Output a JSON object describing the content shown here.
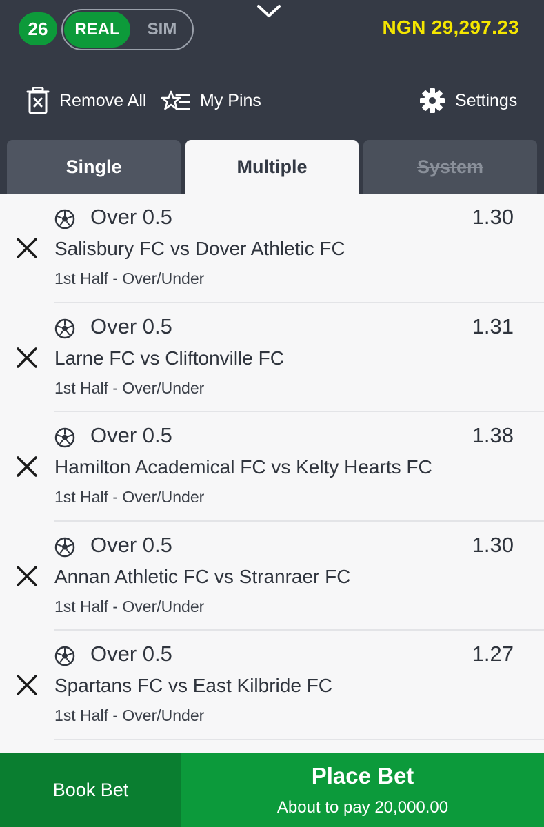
{
  "header": {
    "count_badge": "26",
    "mode": {
      "real_label": "REAL",
      "sim_label": "SIM",
      "selected": "REAL"
    },
    "balance": "NGN 29,297.23",
    "tools": {
      "remove_all": "Remove All",
      "my_pins": "My Pins",
      "settings": "Settings"
    }
  },
  "tabs": [
    {
      "label": "Single",
      "active": false
    },
    {
      "label": "Multiple",
      "active": true
    },
    {
      "label": "System",
      "active": false,
      "disabled": true
    }
  ],
  "bets": [
    {
      "selection": "Over 0.5",
      "odds": "1.30",
      "match": "Salisbury FC vs Dover Athletic FC",
      "market": "1st Half - Over/Under"
    },
    {
      "selection": "Over 0.5",
      "odds": "1.31",
      "match": "Larne FC vs Cliftonville FC",
      "market": "1st Half - Over/Under"
    },
    {
      "selection": "Over 0.5",
      "odds": "1.38",
      "match": "Hamilton Academical FC vs Kelty Hearts FC",
      "market": "1st Half - Over/Under"
    },
    {
      "selection": "Over 0.5",
      "odds": "1.30",
      "match": "Annan Athletic FC vs Stranraer FC",
      "market": "1st Half - Over/Under"
    },
    {
      "selection": "Over 0.5",
      "odds": "1.27",
      "match": "Spartans FC vs East Kilbride FC",
      "market": "1st Half - Over/Under"
    }
  ],
  "footer": {
    "book_bet": "Book Bet",
    "place_bet": "Place Bet",
    "pay_text": "About to pay 20,000.00"
  },
  "icons": {
    "collapse": "chevron-down-icon",
    "remove_all": "trash-x-icon",
    "my_pins": "pin-list-icon",
    "settings": "gear-icon",
    "remove_bet": "close-icon",
    "sport": "soccer-ball-icon"
  },
  "colors": {
    "header_bg": "#353a45",
    "accent_green": "#0c9a3b",
    "balance_yellow": "#f5e600"
  }
}
